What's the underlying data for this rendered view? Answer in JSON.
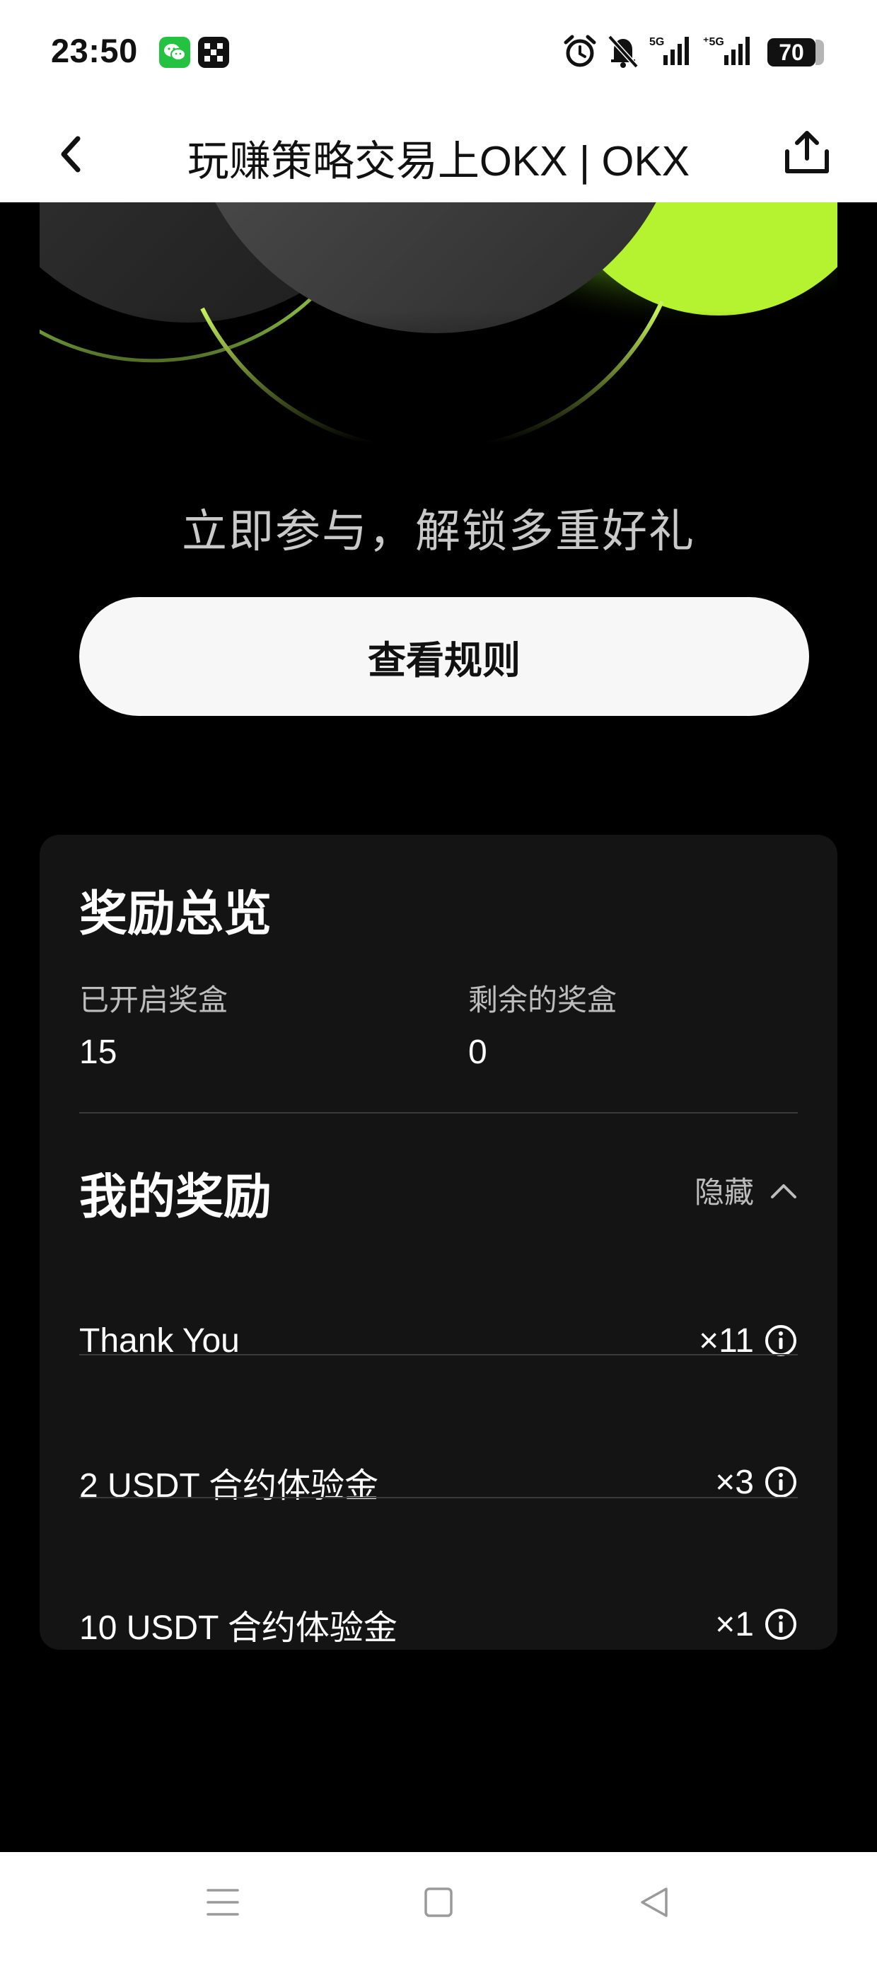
{
  "status_bar": {
    "time": "23:50",
    "battery": "70",
    "icons": [
      "wechat-icon",
      "okx-app-icon",
      "alarm-icon",
      "mute-bell-icon",
      "signal-5g-icon",
      "signal-5g-icon"
    ]
  },
  "nav": {
    "title": "玩赚策略交易上OKX | OKX",
    "back_icon": "chevron-left-icon",
    "share_icon": "share-icon"
  },
  "hero": {
    "subtitle": "立即参与，解锁多重好礼",
    "rules_button": "查看规则",
    "accent_color": "#b8f536"
  },
  "rewards_overview": {
    "title": "奖励总览",
    "opened_label": "已开启奖盒",
    "opened_value": "15",
    "remaining_label": "剩余的奖盒",
    "remaining_value": "0"
  },
  "my_rewards": {
    "title": "我的奖励",
    "toggle_label": "隐藏",
    "items": [
      {
        "name": "Thank You",
        "count": "×11"
      },
      {
        "name": "2 USDT 合约体验金",
        "count": "×3"
      },
      {
        "name": "10 USDT 合约体验金",
        "count": "×1"
      }
    ]
  },
  "system_nav": [
    "menu-icon",
    "home-square-icon",
    "back-triangle-icon"
  ]
}
